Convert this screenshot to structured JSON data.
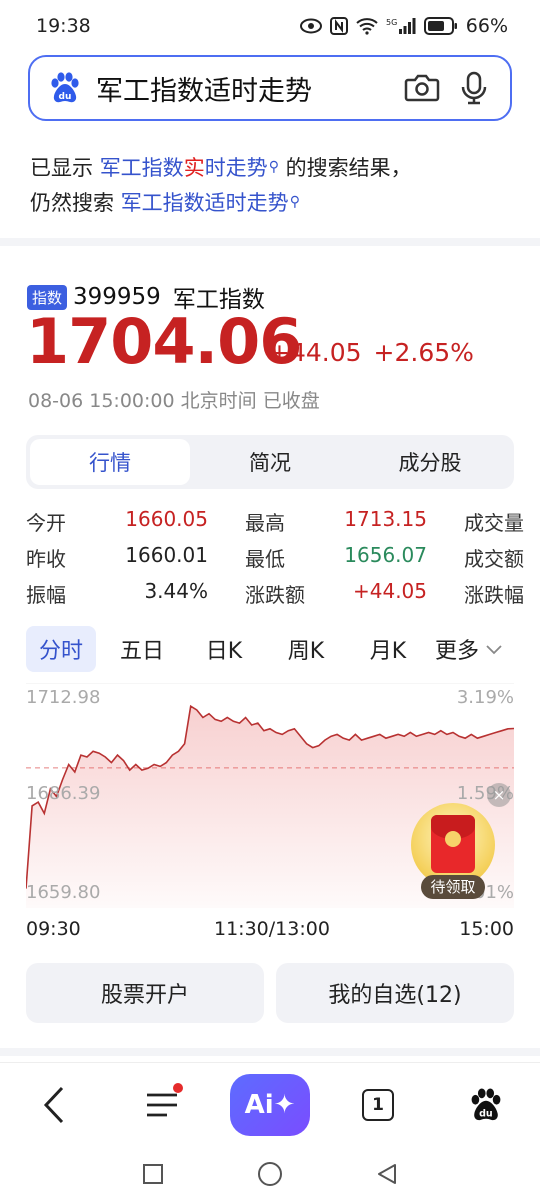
{
  "status_bar": {
    "time": "19:38",
    "battery": "66%",
    "icons": [
      "eye-icon",
      "nfc-icon",
      "wifi-icon",
      "5g-signal-icon",
      "battery-icon"
    ]
  },
  "search": {
    "query": "军工指数适时走势",
    "icons": [
      "baidu-paw-icon",
      "camera-icon",
      "microphone-icon"
    ]
  },
  "hint": {
    "prefix": "已显示",
    "corrected_a": "军工指数",
    "corrected_b": "实",
    "corrected_c": "时走势",
    "suffix": "的搜索结果，",
    "still_prefix": "仍然搜索",
    "original": "军工指数适时走势"
  },
  "stock": {
    "badge": "指数",
    "code": "399959",
    "name": "军工指数",
    "price": "1704.06",
    "change": "+44.05",
    "change_pct": "+2.65%",
    "time": "08-06 15:00:00",
    "timezone": "北京时间",
    "status": "已收盘"
  },
  "tabs": [
    "行情",
    "简况",
    "成分股"
  ],
  "quote": {
    "rows": [
      [
        {
          "label": "今开",
          "value": "1660.05",
          "color": "red"
        },
        {
          "label": "最高",
          "value": "1713.15",
          "color": "red"
        },
        {
          "label": "成交量"
        }
      ],
      [
        {
          "label": "昨收",
          "value": "1660.01",
          "color": "dark"
        },
        {
          "label": "最低",
          "value": "1656.07",
          "color": "green"
        },
        {
          "label": "成交额"
        }
      ],
      [
        {
          "label": "振幅",
          "value": "3.44%",
          "color": "dark"
        },
        {
          "label": "涨跌额",
          "value": "+44.05",
          "color": "red"
        },
        {
          "label": "涨跌幅"
        }
      ]
    ]
  },
  "period_tabs": [
    "分时",
    "五日",
    "日K",
    "周K",
    "月K",
    "更多"
  ],
  "chart_data": {
    "type": "area",
    "y_left_labels": [
      "1712.98",
      "1686.39",
      "1659.80"
    ],
    "y_right_labels": [
      "3.19%",
      "1.59%",
      "0.01%"
    ],
    "x_labels": [
      "09:30",
      "11:30/13:00",
      "15:00"
    ],
    "prev_close": 1660.01,
    "ylim": [
      1659.8,
      1712.98
    ],
    "x": [
      0,
      3,
      6,
      9,
      12,
      15,
      18,
      21,
      24,
      27,
      30,
      33,
      36,
      39,
      42,
      45,
      48,
      51,
      54,
      57,
      60,
      63,
      66,
      69,
      72,
      75,
      78,
      81,
      84,
      87,
      90,
      93,
      96,
      99,
      102,
      105,
      108,
      111,
      114,
      117,
      120,
      123,
      126,
      129,
      132,
      135,
      138,
      141,
      144,
      147,
      150,
      153,
      156,
      159,
      162,
      165,
      168,
      171,
      174,
      177,
      180,
      183,
      186,
      189,
      192,
      195,
      198,
      201,
      204,
      207,
      210,
      213,
      216,
      219,
      222,
      225,
      228,
      231,
      234,
      237,
      240
    ],
    "values": [
      1661.5,
      1683.5,
      1684.5,
      1681.5,
      1688.0,
      1686.0,
      1690.5,
      1694.5,
      1692.5,
      1697.0,
      1696.5,
      1698.0,
      1697.5,
      1696.5,
      1695.0,
      1697.0,
      1695.5,
      1693.0,
      1694.5,
      1693.0,
      1693.5,
      1694.5,
      1694.0,
      1695.0,
      1697.0,
      1698.0,
      1700.0,
      1710.0,
      1709.0,
      1707.0,
      1708.0,
      1706.5,
      1706.0,
      1707.0,
      1706.0,
      1705.5,
      1707.0,
      1705.0,
      1705.5,
      1703.5,
      1704.0,
      1703.0,
      1702.5,
      1703.5,
      1704.0,
      1702.0,
      1700.0,
      1699.0,
      1699.5,
      1701.0,
      1702.0,
      1702.5,
      1701.5,
      1701.0,
      1702.5,
      1701.0,
      1701.5,
      1702.0,
      1702.5,
      1701.5,
      1702.0,
      1702.5,
      1702.0,
      1703.0,
      1702.0,
      1702.5,
      1703.0,
      1702.5,
      1703.5,
      1702.5,
      1703.0,
      1702.0,
      1701.5,
      1702.5,
      1701.5,
      1702.0,
      1702.5,
      1703.0,
      1703.5,
      1704.0,
      1704.06
    ],
    "grid": "dashed-prev-close"
  },
  "red_packet": {
    "label": "待领取",
    "close": "×"
  },
  "actions": {
    "open_account": "股票开户",
    "watchlist": "我的自选(12)"
  },
  "bottom_nav": {
    "ai_label": "Ai✦",
    "tab_count": "1",
    "icons": [
      "back-icon",
      "menu-icon",
      "ai-icon",
      "tabs-icon",
      "baidu-home-icon"
    ]
  },
  "colors": {
    "up": "#c62222",
    "down": "#2a8a5c",
    "accent": "#3553cc"
  }
}
